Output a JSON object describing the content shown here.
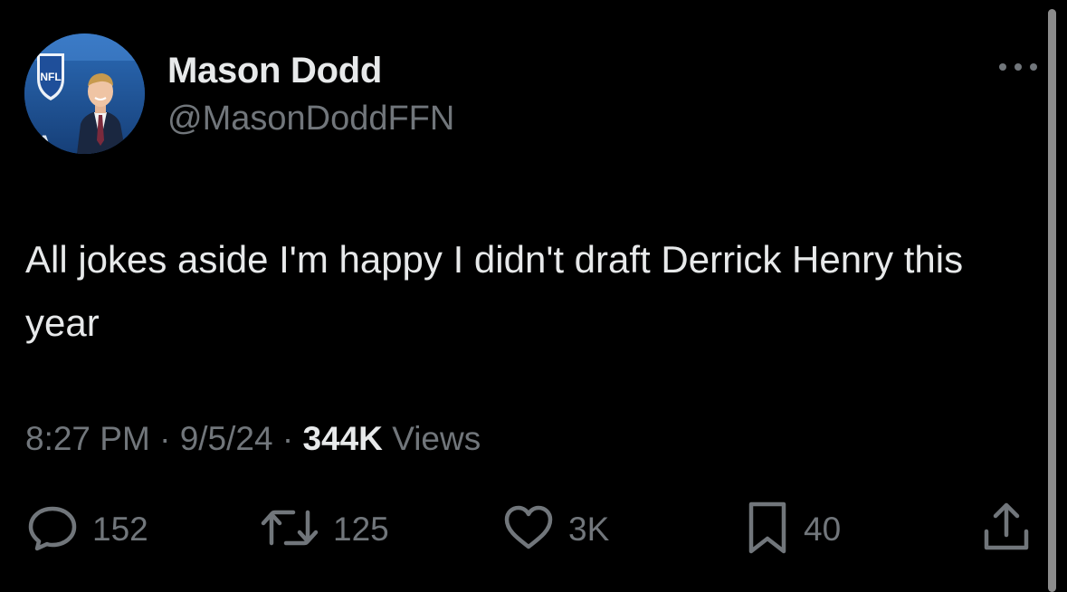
{
  "author": {
    "display_name": "Mason Dodd",
    "handle": "@MasonDoddFFN",
    "avatar_logo_text": "NFL"
  },
  "tweet": {
    "text": "All jokes aside I'm happy I didn't draft Derrick Henry this year"
  },
  "meta": {
    "time": "8:27 PM",
    "separator": "·",
    "date": "9/5/24",
    "views_count": "344K",
    "views_label": "Views"
  },
  "actions": {
    "replies": "152",
    "retweets": "125",
    "likes": "3K",
    "bookmarks": "40"
  },
  "colors": {
    "background": "#000000",
    "primary_text": "#e7e9ea",
    "secondary_text": "#71767b"
  },
  "icons": {
    "more": "more-horizontal-icon",
    "reply": "reply-icon",
    "retweet": "retweet-icon",
    "like": "heart-icon",
    "bookmark": "bookmark-icon",
    "share": "share-icon"
  }
}
